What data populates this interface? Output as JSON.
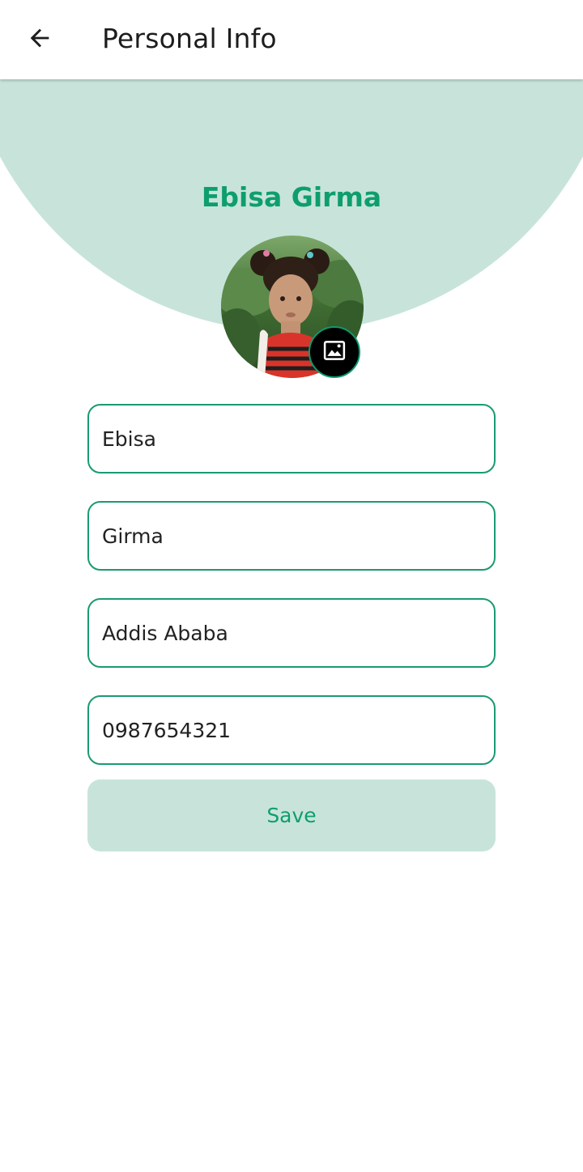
{
  "app_bar": {
    "title": "Personal Info",
    "back_icon": "arrow-left-icon"
  },
  "profile": {
    "name": "Ebisa Girma",
    "avatar_description": "profile photo",
    "change_photo_icon": "image-icon"
  },
  "form": {
    "first_name": "Ebisa",
    "last_name": "Girma",
    "city": "Addis Ababa",
    "phone": "0987654321"
  },
  "save_label": "Save",
  "colors": {
    "hero_background": "#c8e4da",
    "name_text": "#0e9e6e",
    "field_border": "#1a9a72",
    "save_background": "#c8e4da",
    "save_text": "#0e9e6e"
  }
}
